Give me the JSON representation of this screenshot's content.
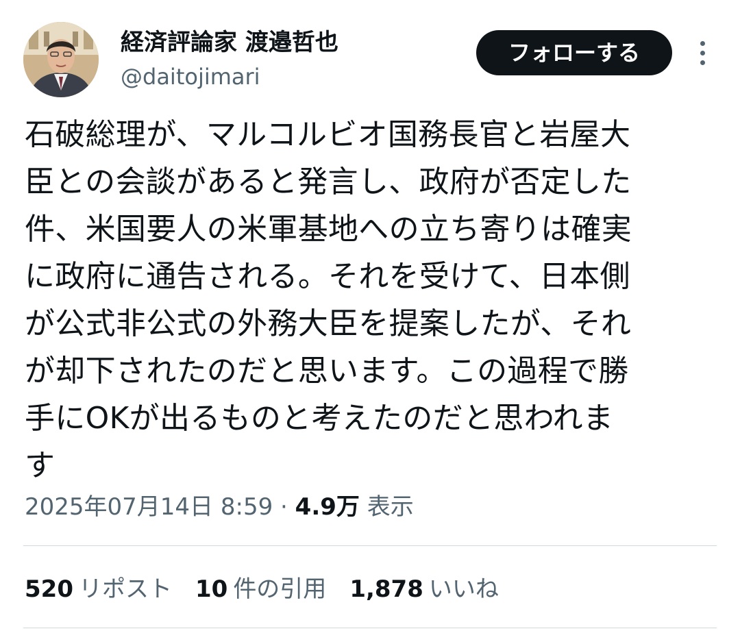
{
  "author": {
    "display_name": "経済評論家 渡邉哲也",
    "handle": "@daitojimari"
  },
  "follow_button": {
    "label": "フォローする"
  },
  "tweet": {
    "text": "石破総理が、マルコルビオ国務長官と岩屋大\n臣との会談があると発言し、政府が否定した\n件、米国要人の米軍基地への立ち寄りは確実\nに政府に通告される。それを受けて、日本側\nが公式非公式の外務大臣を提案したが、それ\nが却下されたのだと思います。この過程で勝\n手にOKが出るものと考えたのだと思われま\nす",
    "timestamp": "2025年07月14日 8:59",
    "separator": "·",
    "views_count": "4.9万",
    "views_label": "表示"
  },
  "stats": {
    "reposts": {
      "count": "520",
      "label": "リポスト"
    },
    "quotes": {
      "count": "10",
      "label": "件の引用"
    },
    "likes": {
      "count": "1,878",
      "label": "いいね"
    }
  },
  "colors": {
    "text": "#0f1419",
    "secondary_text": "#536471",
    "follow_button_bg": "#0f1419",
    "divider": "#cfd9de"
  },
  "icons": {
    "more": "more-dots-icon"
  }
}
